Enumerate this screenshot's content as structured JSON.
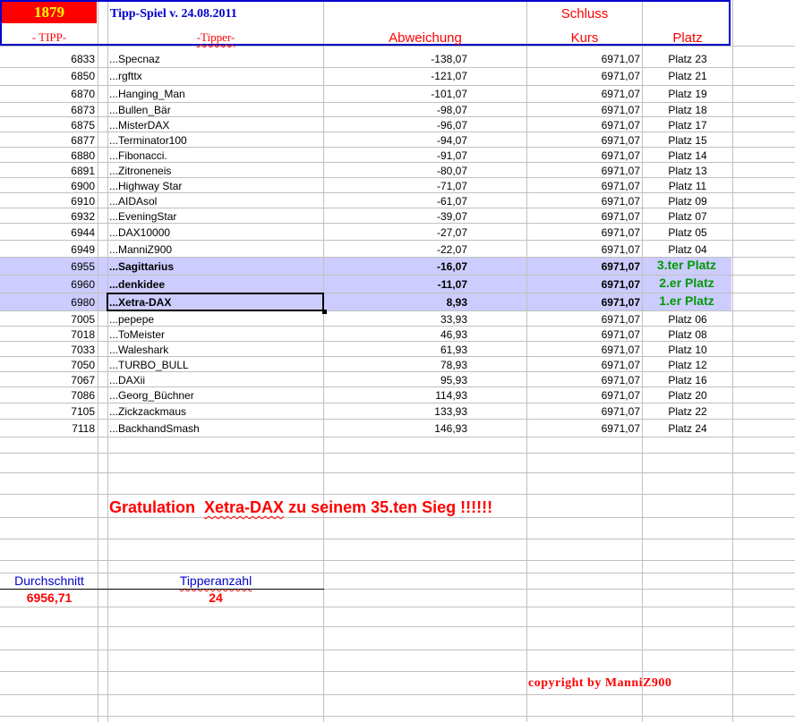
{
  "header": {
    "number": "1879",
    "game_title": "Tipp-Spiel v. 24.08.2011",
    "schluss": "Schluss",
    "col_tipp": "- TIPP-",
    "col_tipper": "-Tipper-",
    "col_abweichung": "Abweichung",
    "col_kurs": "Kurs",
    "col_platz": "Platz"
  },
  "rows": [
    {
      "tipp": "6833",
      "name": "...Specnaz",
      "abw": "-138,07",
      "kurs": "6971,07",
      "platz": "Platz 23"
    },
    {
      "tipp": "6850",
      "name": "...rgfttx",
      "abw": "-121,07",
      "kurs": "6971,07",
      "platz": "Platz 21"
    },
    {
      "tipp": "6870",
      "name": "...Hanging_Man",
      "abw": "-101,07",
      "kurs": "6971,07",
      "platz": "Platz 19"
    },
    {
      "tipp": "6873",
      "name": "...Bullen_Bär",
      "abw": "-98,07",
      "kurs": "6971,07",
      "platz": "Platz 18"
    },
    {
      "tipp": "6875",
      "name": "...MisterDAX",
      "abw": "-96,07",
      "kurs": "6971,07",
      "platz": "Platz 17"
    },
    {
      "tipp": "6877",
      "name": "...Terminator100",
      "abw": "-94,07",
      "kurs": "6971,07",
      "platz": "Platz 15"
    },
    {
      "tipp": "6880",
      "name": "...Fibonacci.",
      "abw": "-91,07",
      "kurs": "6971,07",
      "platz": "Platz 14"
    },
    {
      "tipp": "6891",
      "name": "...Zitroneneis",
      "abw": "-80,07",
      "kurs": "6971,07",
      "platz": "Platz 13"
    },
    {
      "tipp": "6900",
      "name": "...Highway Star",
      "abw": "-71,07",
      "kurs": "6971,07",
      "platz": "Platz 11"
    },
    {
      "tipp": "6910",
      "name": "...AIDAsol",
      "abw": "-61,07",
      "kurs": "6971,07",
      "platz": "Platz 09"
    },
    {
      "tipp": "6932",
      "name": "...EveningStar",
      "abw": "-39,07",
      "kurs": "6971,07",
      "platz": "Platz 07"
    },
    {
      "tipp": "6944",
      "name": "...DAX10000",
      "abw": "-27,07",
      "kurs": "6971,07",
      "platz": "Platz 05"
    },
    {
      "tipp": "6949",
      "name": "...ManniZ900",
      "abw": "-22,07",
      "kurs": "6971,07",
      "platz": "Platz 04"
    },
    {
      "tipp": "6955",
      "name": "...Sagittarius",
      "abw": "-16,07",
      "kurs": "6971,07",
      "platz": "3.ter Platz"
    },
    {
      "tipp": "6960",
      "name": "...denkidee",
      "abw": "-11,07",
      "kurs": "6971,07",
      "platz": "2.er Platz"
    },
    {
      "tipp": "6980",
      "name": "...Xetra-DAX",
      "abw": "8,93",
      "kurs": "6971,07",
      "platz": "1.er Platz"
    },
    {
      "tipp": "7005",
      "name": "...pepepe",
      "abw": "33,93",
      "kurs": "6971,07",
      "platz": "Platz 06"
    },
    {
      "tipp": "7018",
      "name": "...ToMeister",
      "abw": "46,93",
      "kurs": "6971,07",
      "platz": "Platz 08"
    },
    {
      "tipp": "7033",
      "name": "...Waleshark",
      "abw": "61,93",
      "kurs": "6971,07",
      "platz": "Platz 10"
    },
    {
      "tipp": "7050",
      "name": "...TURBO_BULL",
      "abw": "78,93",
      "kurs": "6971,07",
      "platz": "Platz 12"
    },
    {
      "tipp": "7067",
      "name": "...DAXii",
      "abw": "95,93",
      "kurs": "6971,07",
      "platz": "Platz 16"
    },
    {
      "tipp": "7086",
      "name": "...Georg_Büchner",
      "abw": "114,93",
      "kurs": "6971,07",
      "platz": "Platz 20"
    },
    {
      "tipp": "7105",
      "name": "...Zickzackmaus",
      "abw": "133,93",
      "kurs": "6971,07",
      "platz": "Platz 22"
    },
    {
      "tipp": "7118",
      "name": "...BackhandSmash",
      "abw": "146,93",
      "kurs": "6971,07",
      "platz": "Platz 24"
    }
  ],
  "congrats": {
    "prefix": "Gratulation",
    "winner": "Xetra-DAX",
    "suffix": "zu seinem 35.ten Sieg !!!!!!"
  },
  "stats": {
    "avg_label": "Durchschnitt",
    "avg_value": "6956,71",
    "count_label": "Tipperanzahl",
    "count_value": "24"
  },
  "copyright": "copyright by ManniZ900",
  "colors": {
    "highlight": "#ccccff",
    "accent_red": "#ff0000",
    "accent_blue": "#0000cc",
    "podium_green": "#009900"
  }
}
